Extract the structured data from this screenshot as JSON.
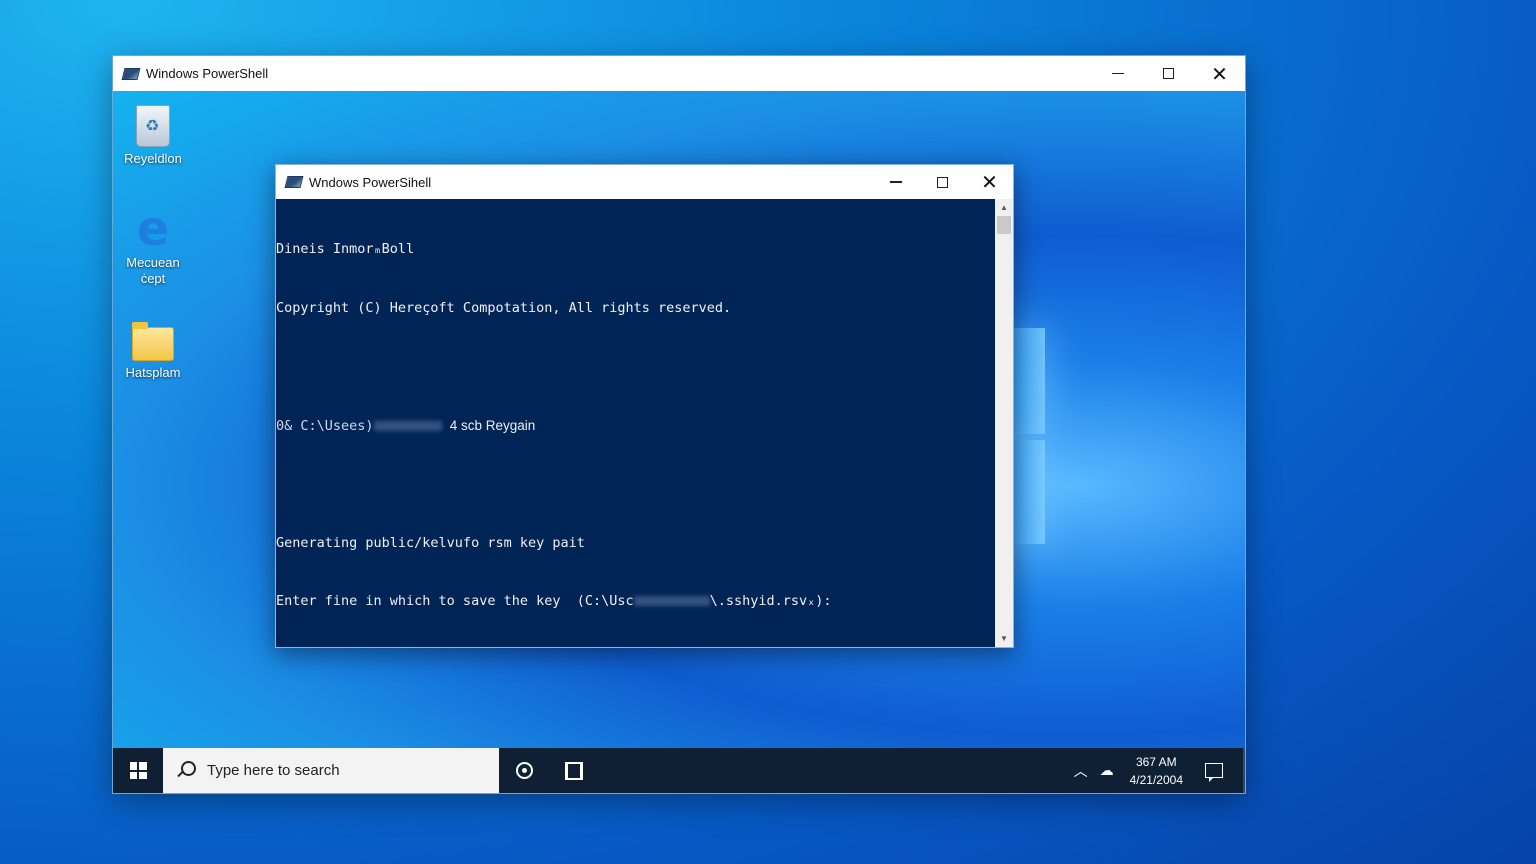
{
  "outer_window": {
    "title": "Windows PowerShell",
    "icon": "powershell-icon",
    "controls": [
      "minimize-icon",
      "maximize-icon",
      "close-icon"
    ]
  },
  "desktop_icons": [
    {
      "label": "Reyeldlon",
      "icon": "recycle-bin-icon"
    },
    {
      "label": "Mecuean\nċept",
      "icon": "edge-icon"
    },
    {
      "label": "Hatsplam",
      "icon": "folder-icon"
    }
  ],
  "inner_window": {
    "title": "Wndows PowerSihell",
    "icon": "powershell-icon",
    "console_lines": [
      "Dineis InmorₘBoll",
      "Copyright (C) Hereçoft Compotation, All rights reserved.",
      "",
      "0& C:\\Usees)",
      "4 scb Reygain",
      "",
      "Generating public/kelvufo rsm key pait",
      "Enter fine in which to save the key  (C:\\Usc",
      "\\.sshyid.rsvₓ):"
    ]
  },
  "taskbar": {
    "search_placeholder": "Type here to search",
    "time": "367 AM",
    "date": "4/21/2004"
  },
  "colors": {
    "console_bg": "#012456",
    "taskbar_bg": "#0f2034",
    "desktop_accent": "#1a7fe8"
  }
}
